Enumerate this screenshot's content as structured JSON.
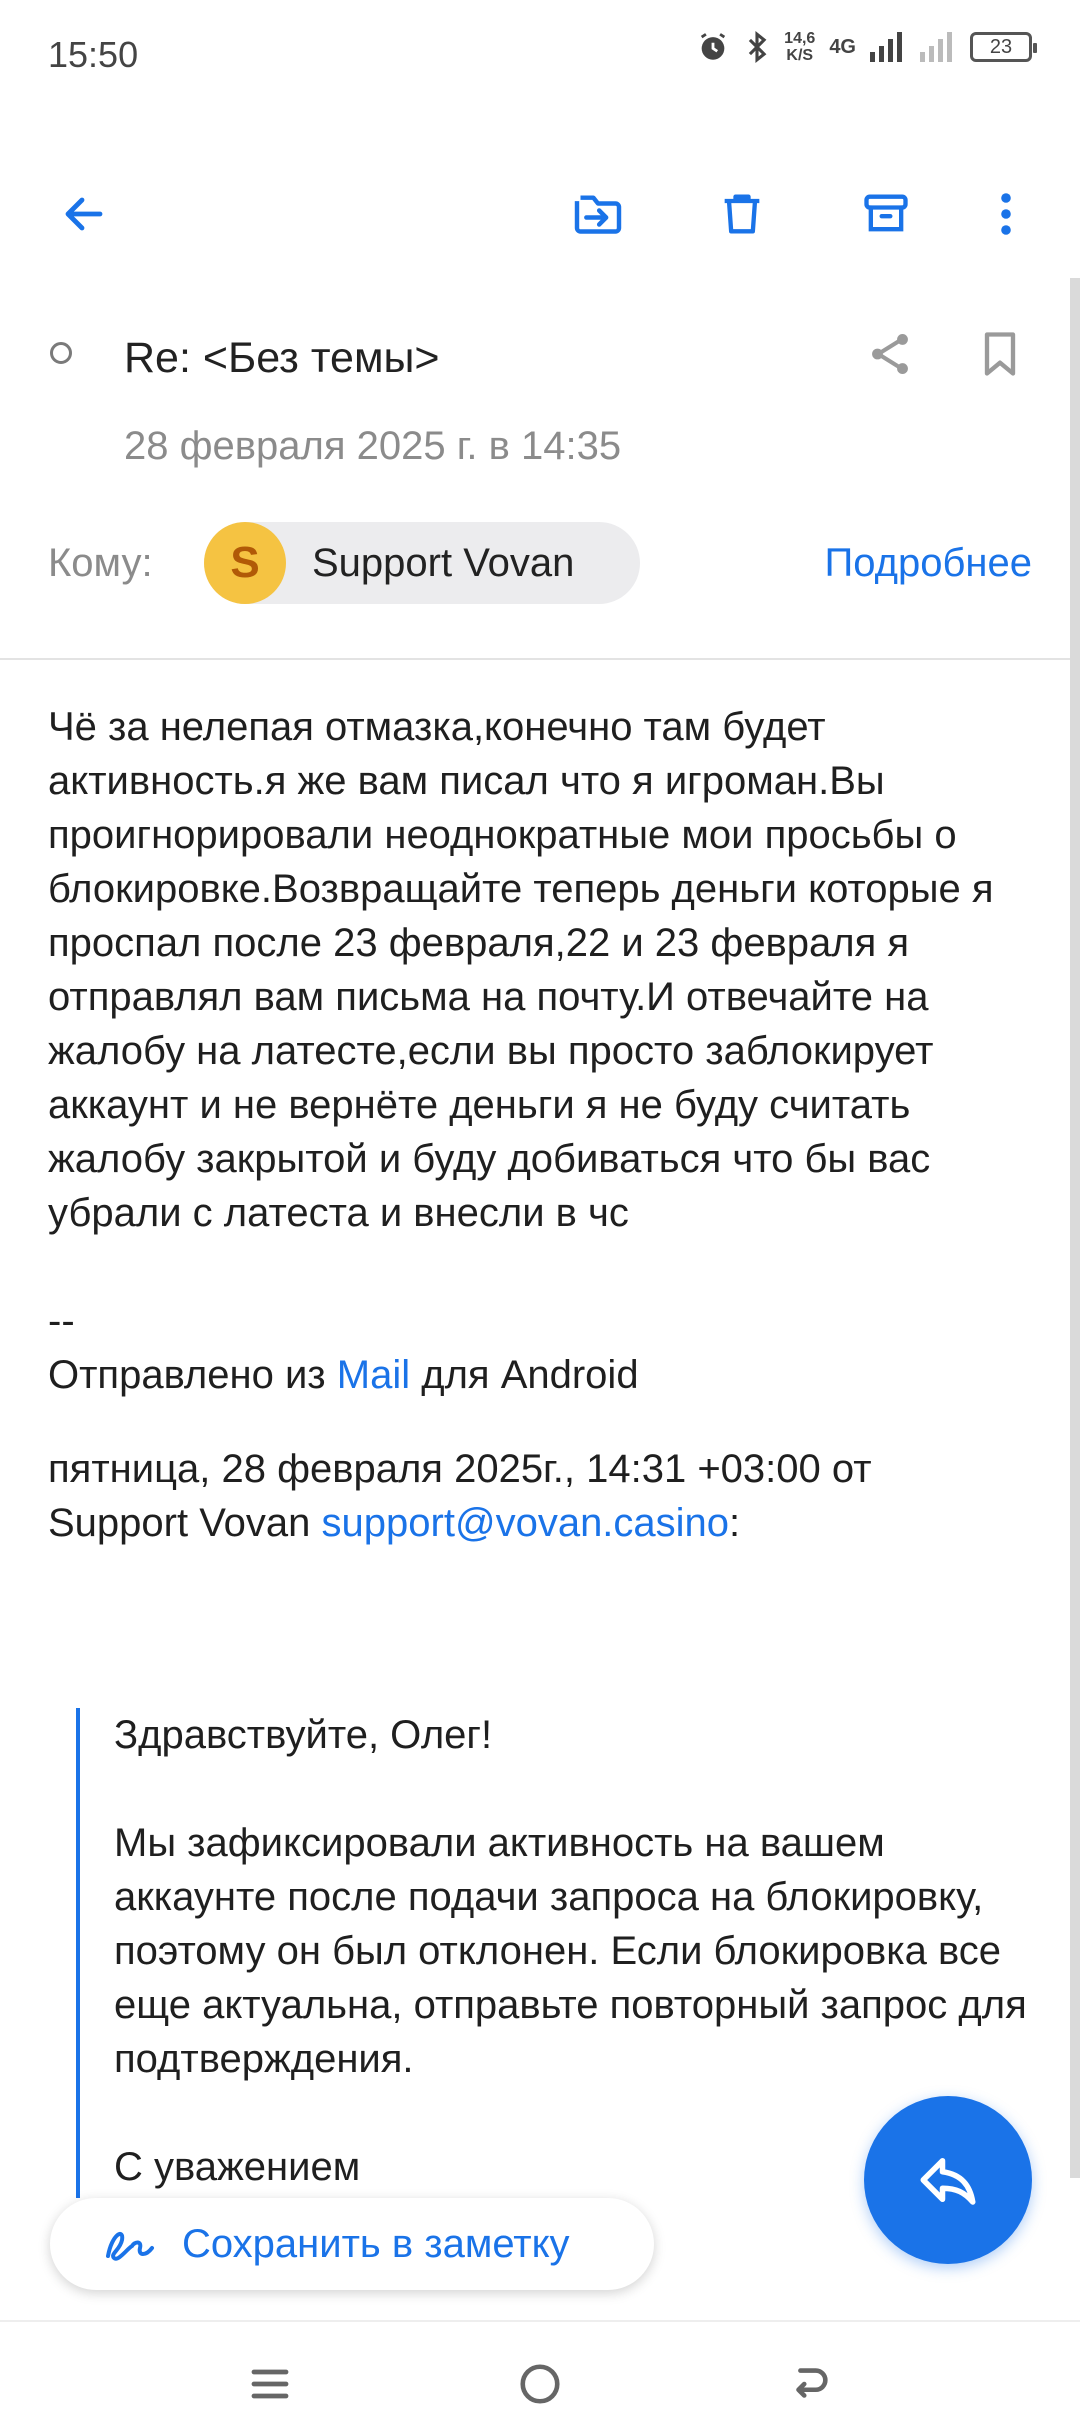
{
  "status_bar": {
    "time": "15:50",
    "net_speed_value": "14,6",
    "net_speed_unit": "K/S",
    "network": "4G",
    "battery": "23"
  },
  "toolbar": {
    "back_icon": "arrow-left-icon",
    "move_icon": "move-to-folder-icon",
    "delete_icon": "trash-icon",
    "archive_icon": "archive-icon",
    "more_icon": "more-vertical-icon"
  },
  "header": {
    "subject": "Re: <Без темы>",
    "date": "28 февраля 2025 г. в 14:35",
    "to_label": "Кому:",
    "recipient_initial": "S",
    "recipient_name": "Support Vovan",
    "details_link": "Подробнее"
  },
  "message": {
    "text": "Чё за нелепая отмазка,конечно там будет активность.я же вам писал что я игроман.Вы проигнорировали неоднократные мои просьбы о блокировке.Возвращайте теперь деньги которые я проспал после 23 февраля,22 и 23 февраля я отправлял вам письма на почту.И отвечайте на жалобу на латесте,если вы просто заблокирует аккаунт и не вернёте деньги я не буду считать жалобу закрытой и буду добиваться что бы вас убрали с латеста и внесли в чс",
    "signature_sep": "--",
    "signature_prefix": "Отправлено из",
    "signature_link": "Mail",
    "signature_suffix": "для Android",
    "quote_header_line1": "пятница, 28 февраля 2025г., 14:31 +03:00 от",
    "quote_sender": "Support Vovan",
    "quote_email": "support@vovan.casino",
    "quote_colon": ":"
  },
  "quoted": {
    "greeting": "Здравствуйте, Олег!",
    "body": "Мы зафиксировали активность на вашем аккаунте после подачи запроса на блокировку, поэтому он был отклонен. Если блокировка все еще актуальна, отправьте повторный запрос для подтверждения.",
    "closing": "С уважением"
  },
  "actions": {
    "save_note_label": "Сохранить в заметку",
    "reply_icon": "reply-icon"
  },
  "colors": {
    "accent": "#1a73e8",
    "avatar_bg": "#f5c342",
    "avatar_text": "#b15a07"
  }
}
